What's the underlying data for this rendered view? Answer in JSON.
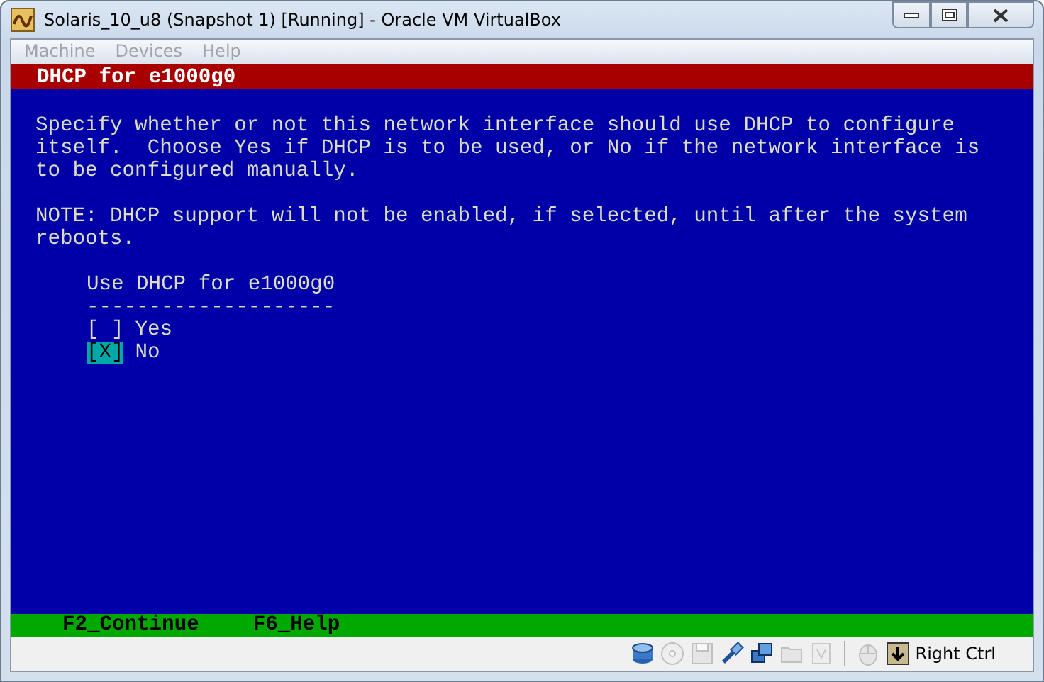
{
  "window": {
    "title": "Solaris_10_u8 (Snapshot 1) [Running] - Oracle VM VirtualBox"
  },
  "menu": [
    {
      "label": "Machine",
      "disabled": true
    },
    {
      "label": "Devices",
      "disabled": true
    },
    {
      "label": "Help",
      "disabled": true
    }
  ],
  "console": {
    "header": "DHCP for e1000g0",
    "paragraphs": [
      {
        "lines": [
          "Specify whether or not this network interface should use DHCP to configure",
          "itself.  Choose Yes if DHCP is to be used, or No if the network interface is",
          "to be configured manually."
        ]
      },
      {
        "lines": [
          "NOTE: DHCP support will not be enabled, if selected, until after the system",
          "reboots."
        ]
      }
    ],
    "question": "Use DHCP for e1000g0",
    "rule": "--------------------",
    "options": [
      {
        "box": "[ ]",
        "label": "Yes",
        "selected": false
      },
      {
        "box": "[X]",
        "label": "No",
        "selected": true
      }
    ],
    "footer": [
      "F2_Continue",
      "F6_Help"
    ]
  },
  "status_bar": {
    "icons": [
      {
        "kind": "hdd",
        "disabled": false
      },
      {
        "kind": "cd",
        "disabled": true
      },
      {
        "kind": "floppy",
        "disabled": true
      },
      {
        "kind": "usb",
        "disabled": false
      },
      {
        "kind": "network",
        "disabled": false
      },
      {
        "kind": "folder",
        "disabled": true
      },
      {
        "kind": "chip",
        "disabled": true
      },
      {
        "kind": "mouse",
        "disabled": true
      },
      {
        "kind": "keyboard",
        "disabled": false
      }
    ],
    "host_key": "Right Ctrl"
  }
}
